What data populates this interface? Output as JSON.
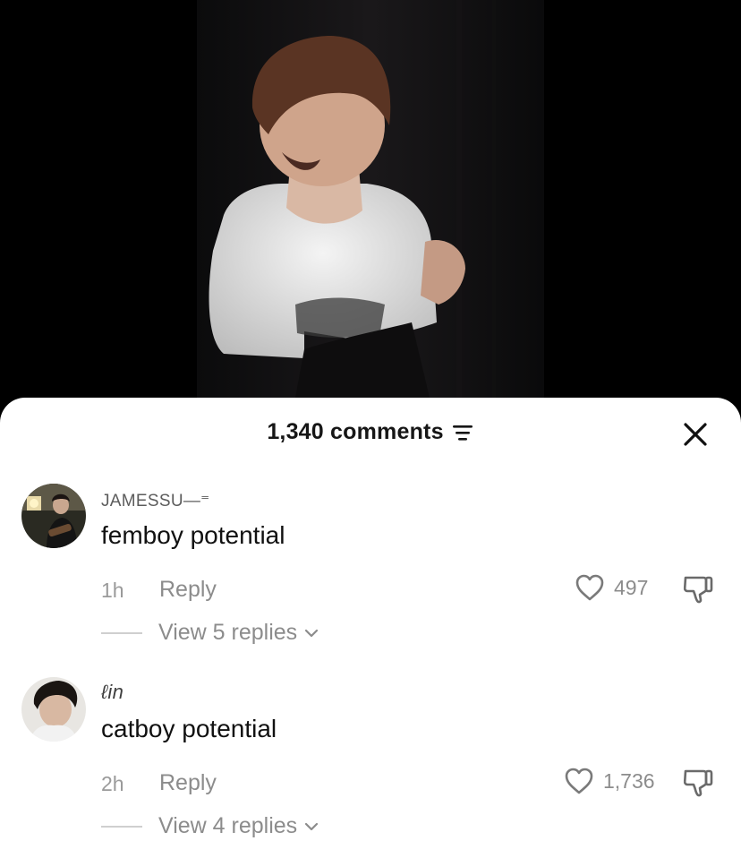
{
  "header": {
    "comment_count": "1,340 comments",
    "sort_icon": "sort-icon",
    "close_icon": "close-icon"
  },
  "comments": [
    {
      "username": "JAMESSU—⁼",
      "text": "femboy potential",
      "time": "1h",
      "reply_label": "Reply",
      "likes": "497",
      "view_replies": "View 5 replies"
    },
    {
      "username": "ℓin",
      "text": "catboy potential",
      "time": "2h",
      "reply_label": "Reply",
      "likes": "1,736",
      "view_replies": "View 4 replies"
    }
  ],
  "colors": {
    "sheet_bg": "#ffffff",
    "text_primary": "#111111",
    "text_secondary": "#8c8c8c",
    "video_bg": "#000000"
  }
}
